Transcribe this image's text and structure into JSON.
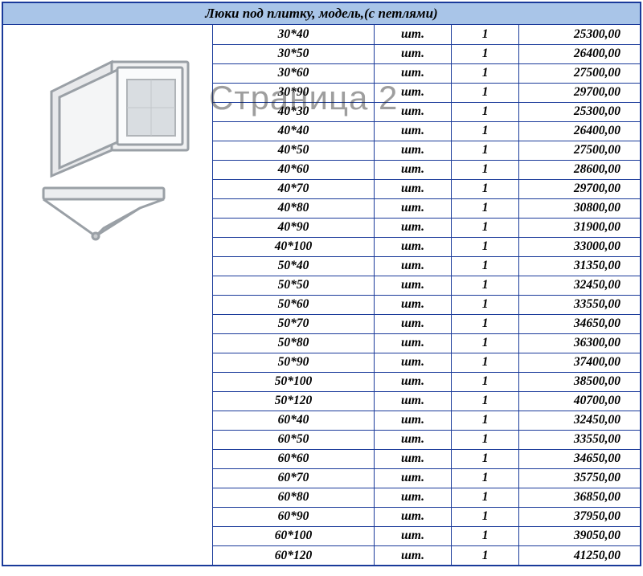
{
  "header": "Люки под плитку, модель,(с петлями)",
  "watermark": "Страница 2",
  "unit_label": "шт.",
  "qty_label": "1",
  "rows": [
    {
      "size": "30*40",
      "price": "25300,00"
    },
    {
      "size": "30*50",
      "price": "26400,00"
    },
    {
      "size": "30*60",
      "price": "27500,00"
    },
    {
      "size": "30*90",
      "price": "29700,00"
    },
    {
      "size": "40*30",
      "price": "25300,00"
    },
    {
      "size": "40*40",
      "price": "26400,00"
    },
    {
      "size": "40*50",
      "price": "27500,00"
    },
    {
      "size": "40*60",
      "price": "28600,00"
    },
    {
      "size": "40*70",
      "price": "29700,00"
    },
    {
      "size": "40*80",
      "price": "30800,00"
    },
    {
      "size": "40*90",
      "price": "31900,00"
    },
    {
      "size": "40*100",
      "price": "33000,00"
    },
    {
      "size": "50*40",
      "price": "31350,00"
    },
    {
      "size": "50*50",
      "price": "32450,00"
    },
    {
      "size": "50*60",
      "price": "33550,00"
    },
    {
      "size": "50*70",
      "price": "34650,00"
    },
    {
      "size": "50*80",
      "price": "36300,00"
    },
    {
      "size": "50*90",
      "price": "37400,00"
    },
    {
      "size": "50*100",
      "price": "38500,00"
    },
    {
      "size": "50*120",
      "price": "40700,00"
    },
    {
      "size": "60*40",
      "price": "32450,00"
    },
    {
      "size": "60*50",
      "price": "33550,00"
    },
    {
      "size": "60*60",
      "price": "34650,00"
    },
    {
      "size": "60*70",
      "price": "35750,00"
    },
    {
      "size": "60*80",
      "price": "36850,00"
    },
    {
      "size": "60*90",
      "price": "37950,00"
    },
    {
      "size": "60*100",
      "price": "39050,00"
    },
    {
      "size": "60*120",
      "price": "41250,00"
    }
  ]
}
